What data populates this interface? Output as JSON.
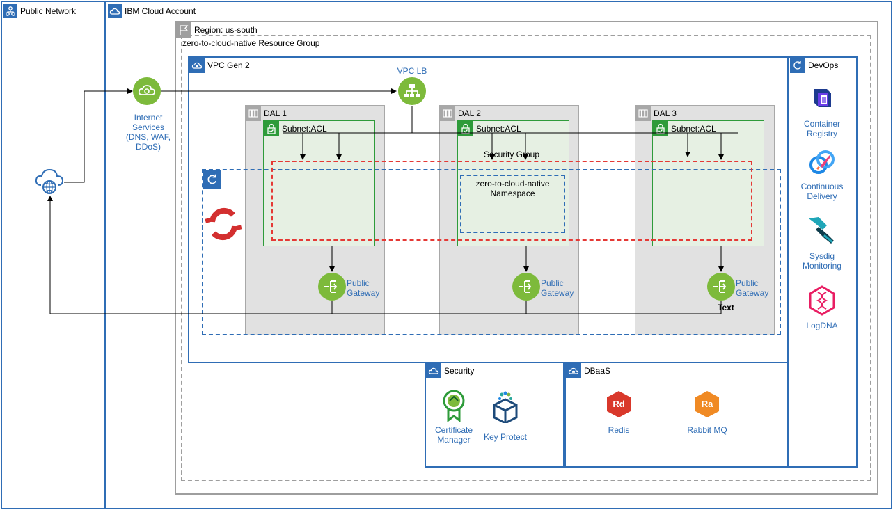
{
  "public_network": {
    "label": "Public Network"
  },
  "ibm_cloud": {
    "label": "IBM Cloud Account"
  },
  "region": {
    "label": "Region: us-south"
  },
  "resource_group": {
    "label": "zero-to-cloud-native Resource Group"
  },
  "vpc": {
    "label": "VPC Gen 2"
  },
  "vpc_lb": {
    "label": "VPC LB"
  },
  "internet_services": {
    "line1": "Internet",
    "line2": "Services",
    "line3": "(DNS, WAF,",
    "line4": "DDoS)"
  },
  "zones": [
    {
      "label": "DAL 1",
      "subnet": "Subnet:ACL",
      "gateway_line1": "Public",
      "gateway_line2": "Gateway"
    },
    {
      "label": "DAL 2",
      "subnet": "Subnet:ACL",
      "gateway_line1": "Public",
      "gateway_line2": "Gateway"
    },
    {
      "label": "DAL 3",
      "subnet": "Subnet:ACL",
      "gateway_line1": "Public",
      "gateway_line2": "Gateway"
    }
  ],
  "security_group": {
    "label": "Security Group"
  },
  "namespace": {
    "line1": "zero-to-cloud-native",
    "line2": "Namespace"
  },
  "text_label": "Text",
  "devops": {
    "label": "DevOps",
    "items": [
      {
        "line1": "Container",
        "line2": "Registry"
      },
      {
        "line1": "Continuous",
        "line2": "Delivery"
      },
      {
        "line1": "Sysdig",
        "line2": "Monitoring"
      },
      {
        "line1": "LogDNA",
        "line2": ""
      }
    ]
  },
  "security": {
    "label": "Security",
    "cert_line1": "Certificate",
    "cert_line2": "Manager",
    "key_protect": "Key Protect"
  },
  "dbaas": {
    "label": "DBaaS",
    "redis_badge": "Rd",
    "redis": "Redis",
    "rabbit_badge": "Ra",
    "rabbit": "Rabbit MQ"
  },
  "colors": {
    "blue_border": "#2f6db5",
    "green": "#7dba3b",
    "subnet_border": "#2e9b3a",
    "subnet_fill": "#e6f0e3",
    "zone_fill": "#e1e1e1",
    "red_dash": "#e53935",
    "redis": "#d9382b",
    "rabbit": "#f08a24"
  }
}
